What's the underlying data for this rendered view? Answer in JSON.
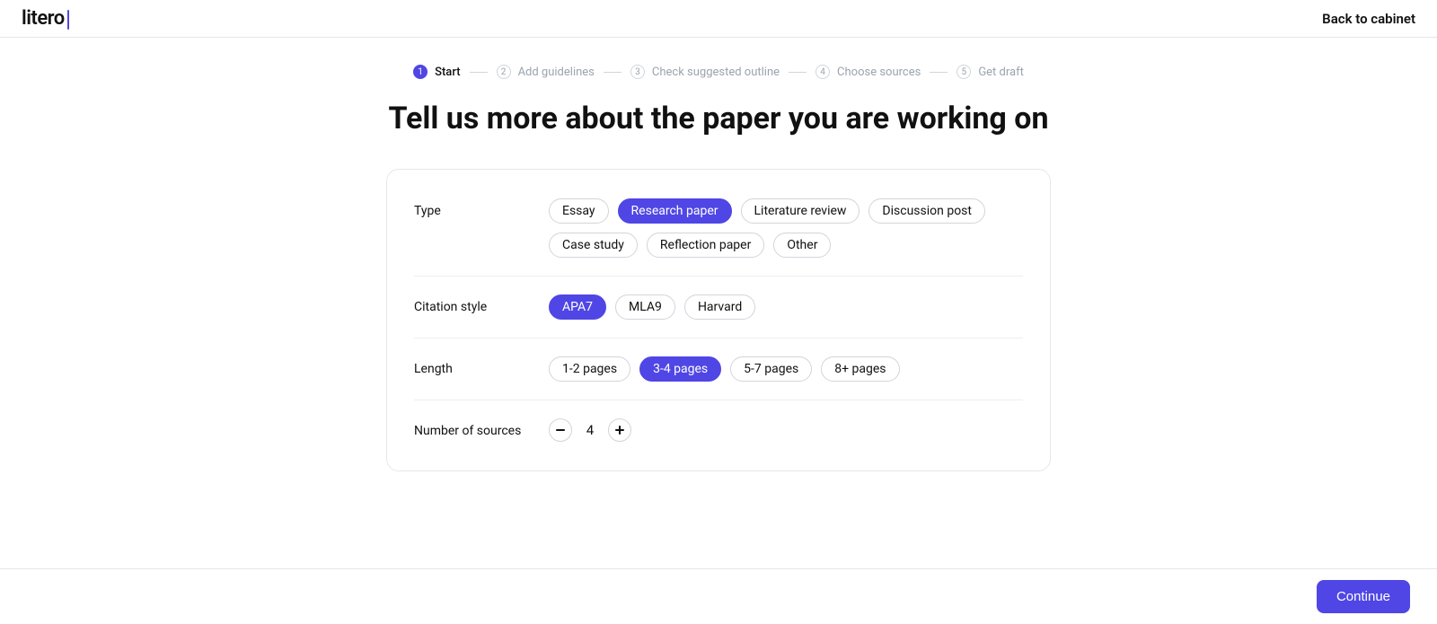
{
  "header": {
    "logo": "litero",
    "back_link": "Back to cabinet"
  },
  "steps": [
    {
      "num": "1",
      "label": "Start",
      "active": true
    },
    {
      "num": "2",
      "label": "Add guidelines",
      "active": false
    },
    {
      "num": "3",
      "label": "Check suggested outline",
      "active": false
    },
    {
      "num": "4",
      "label": "Choose sources",
      "active": false
    },
    {
      "num": "5",
      "label": "Get draft",
      "active": false
    }
  ],
  "title": "Tell us more about the paper you are working on",
  "form": {
    "type": {
      "label": "Type",
      "options": [
        {
          "label": "Essay",
          "selected": false
        },
        {
          "label": "Research paper",
          "selected": true
        },
        {
          "label": "Literature review",
          "selected": false
        },
        {
          "label": "Discussion post",
          "selected": false
        },
        {
          "label": "Case study",
          "selected": false
        },
        {
          "label": "Reflection paper",
          "selected": false
        },
        {
          "label": "Other",
          "selected": false
        }
      ]
    },
    "citation": {
      "label": "Citation style",
      "options": [
        {
          "label": "APA7",
          "selected": true
        },
        {
          "label": "MLA9",
          "selected": false
        },
        {
          "label": "Harvard",
          "selected": false
        }
      ]
    },
    "length": {
      "label": "Length",
      "options": [
        {
          "label": "1-2 pages",
          "selected": false
        },
        {
          "label": "3-4 pages",
          "selected": true
        },
        {
          "label": "5-7 pages",
          "selected": false
        },
        {
          "label": "8+ pages",
          "selected": false
        }
      ]
    },
    "sources": {
      "label": "Number of sources",
      "value": "4"
    }
  },
  "footer": {
    "continue_label": "Continue"
  }
}
